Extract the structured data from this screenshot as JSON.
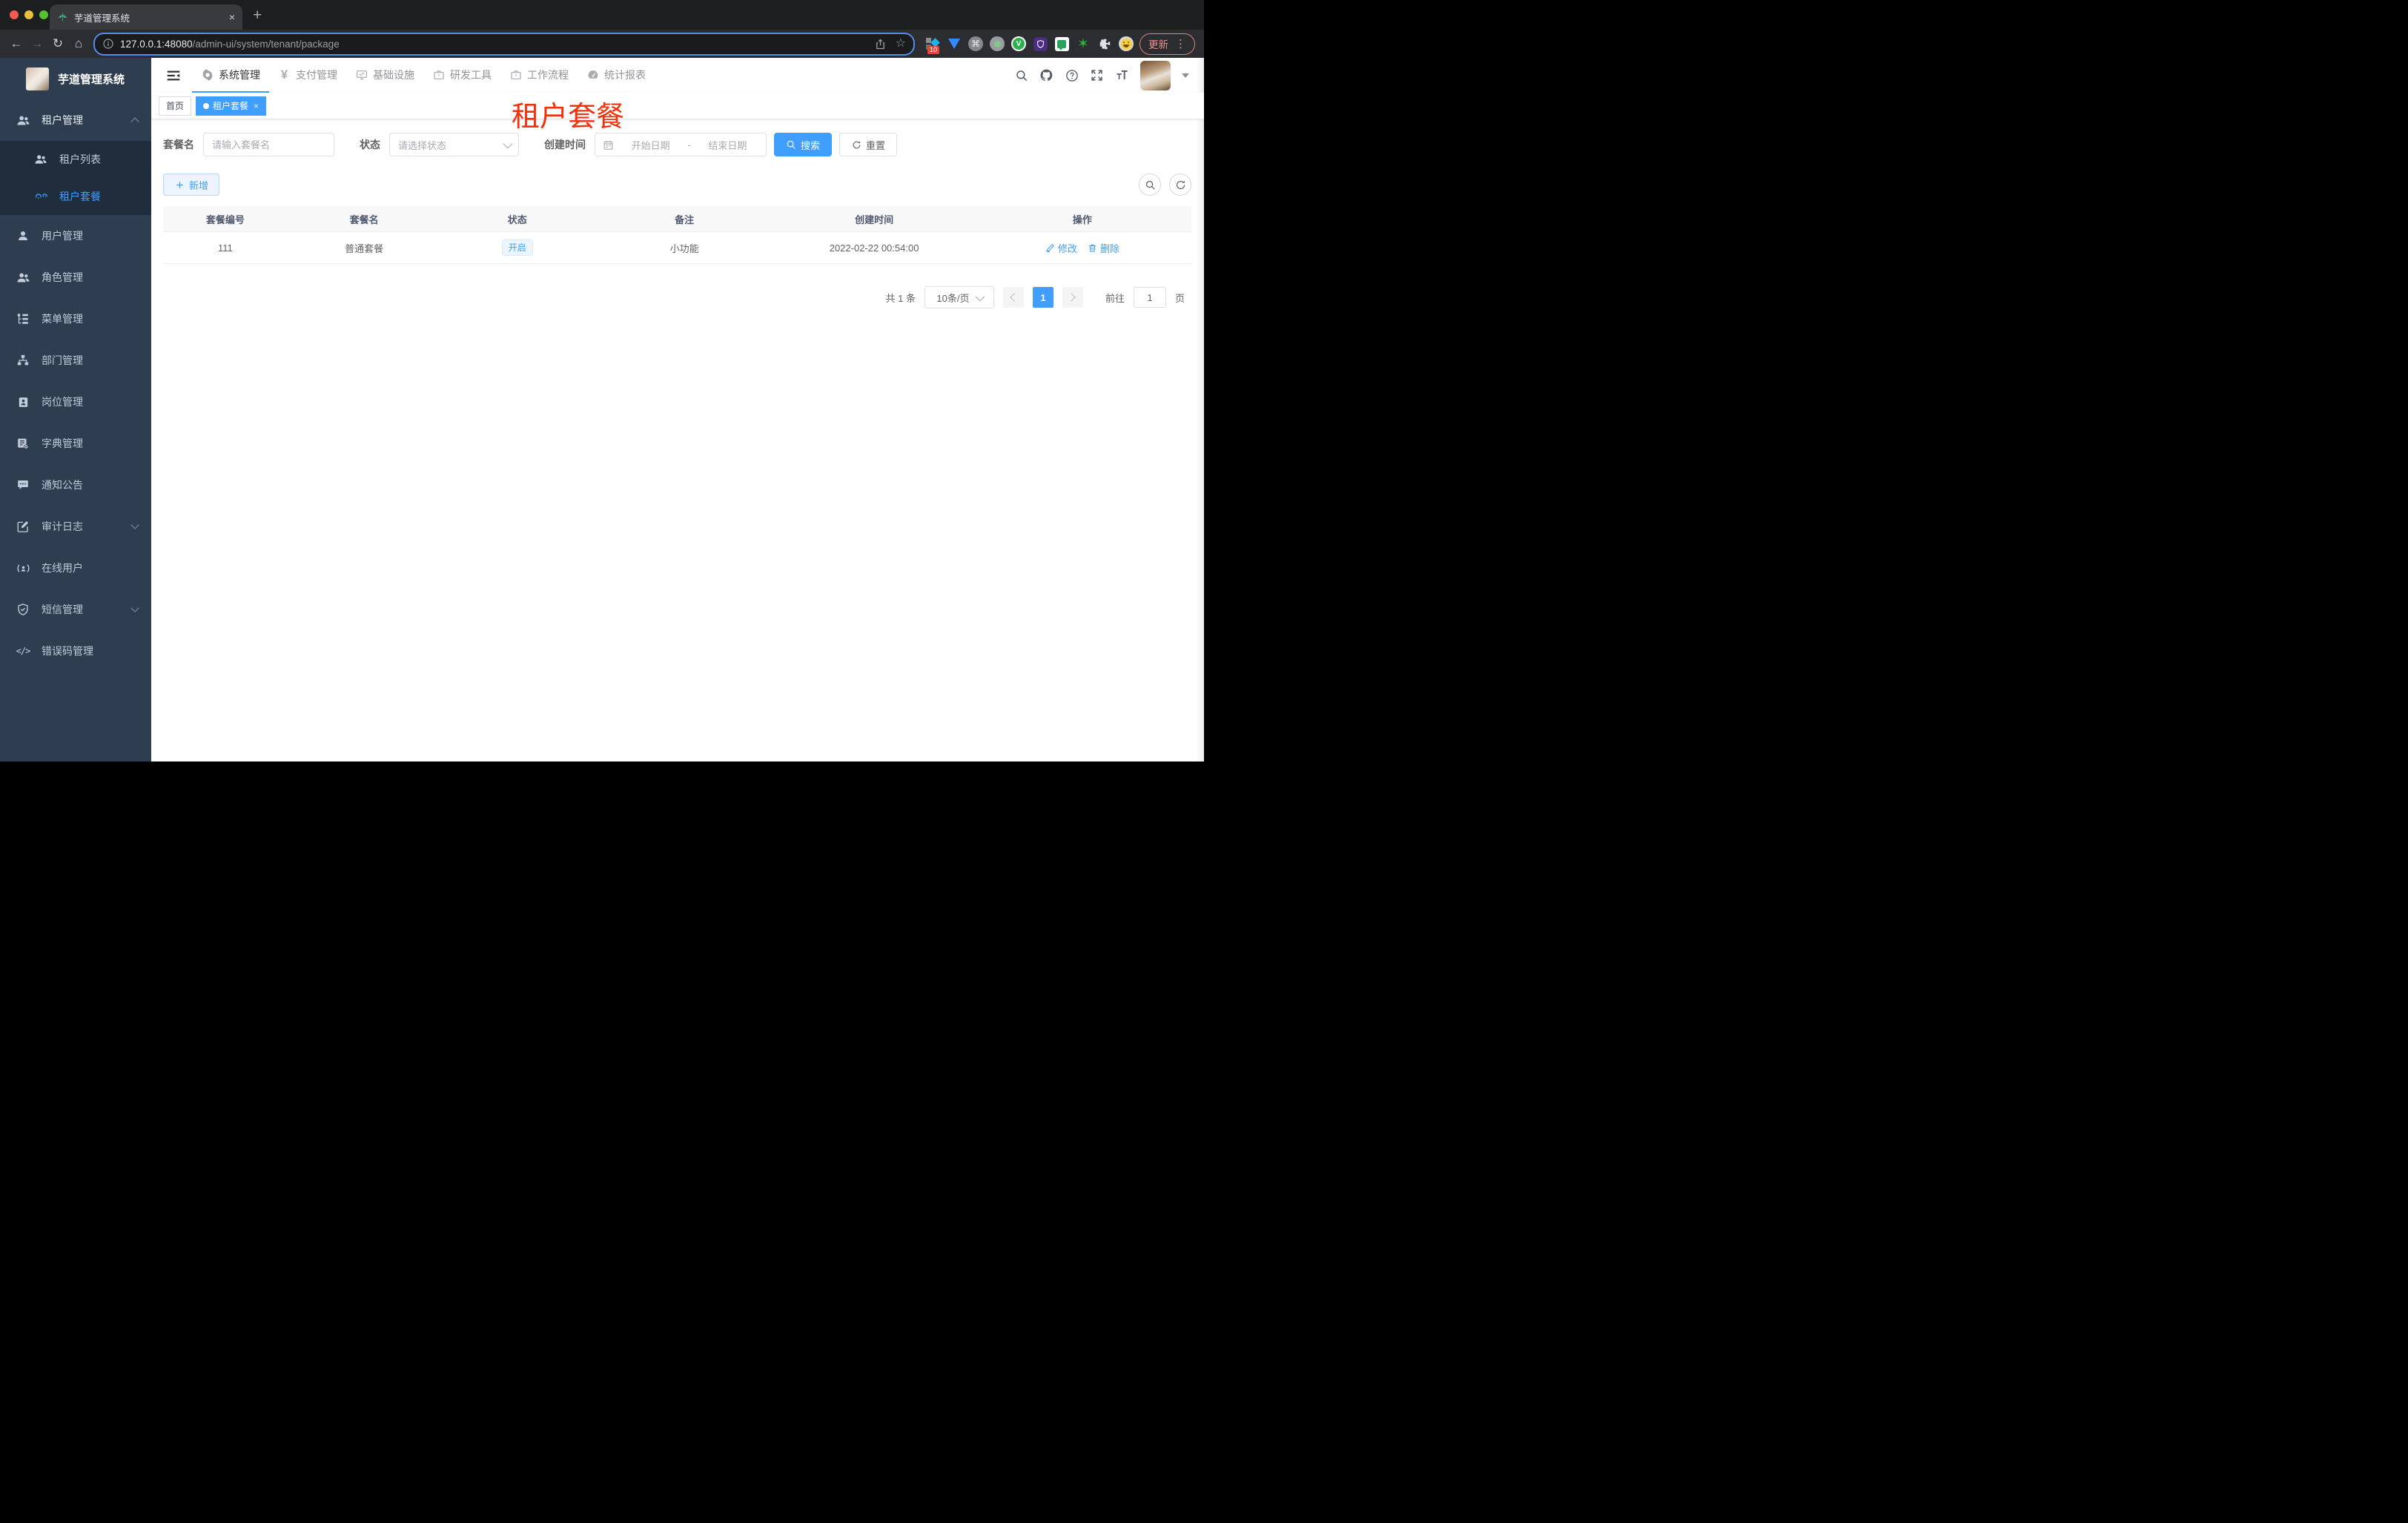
{
  "browser": {
    "tab_title": "芋道管理系统",
    "tab_close": "×",
    "new_tab": "+",
    "back": "←",
    "forward": "→",
    "reload": "↻",
    "home": "⌂",
    "url_host": "127.0.0.1:48080",
    "url_path": "/admin-ui/system/tenant/package",
    "star": "☆",
    "extension_badge": "10",
    "ext_command": "⌘",
    "ext_vue": "V",
    "ext_star": "✶",
    "update_label": "更新",
    "menu_dots": "⋮"
  },
  "sidebar": {
    "logo_title": "芋道管理系统",
    "tenant_group": {
      "label": "租户管理",
      "children": [
        {
          "label": "租户列表"
        },
        {
          "label": "租户套餐"
        }
      ]
    },
    "items": [
      {
        "label": "用户管理"
      },
      {
        "label": "角色管理"
      },
      {
        "label": "菜单管理"
      },
      {
        "label": "部门管理"
      },
      {
        "label": "岗位管理"
      },
      {
        "label": "字典管理"
      },
      {
        "label": "通知公告"
      },
      {
        "label": "审计日志"
      },
      {
        "label": "在线用户"
      },
      {
        "label": "短信管理"
      },
      {
        "label": "错误码管理"
      }
    ]
  },
  "topnav": {
    "yen": "¥",
    "items": [
      {
        "label": "系统管理"
      },
      {
        "label": "支付管理"
      },
      {
        "label": "基础设施"
      },
      {
        "label": "研发工具"
      },
      {
        "label": "工作流程"
      },
      {
        "label": "统计报表"
      }
    ]
  },
  "tags": {
    "home": "首页",
    "active": "租户套餐",
    "close": "×"
  },
  "overlay_title": "租户套餐",
  "filters": {
    "name_label": "套餐名",
    "name_placeholder": "请输入套餐名",
    "status_label": "状态",
    "status_placeholder": "请选择状态",
    "date_label": "创建时间",
    "date_start": "开始日期",
    "date_separator": "-",
    "date_end": "结束日期",
    "search_label": "搜索",
    "reset_label": "重置",
    "add_label": "新增"
  },
  "table": {
    "headers": [
      "套餐编号",
      "套餐名",
      "状态",
      "备注",
      "创建时间",
      "操作"
    ],
    "rows": [
      {
        "id": "111",
        "name": "普通套餐",
        "status": "开启",
        "remark": "小功能",
        "created": "2022-02-22 00:54:00",
        "edit": "修改",
        "delete": "删除"
      }
    ]
  },
  "pagination": {
    "total": "共 1 条",
    "page_size": "10条/页",
    "page": "1",
    "goto_label": "前往",
    "goto_value": "1",
    "unit": "页"
  },
  "colors": {
    "primary": "#409eff",
    "overlay_red": "#f2300c",
    "sidebar_bg": "#2f3d50",
    "submenu_bg": "#1f2d3d"
  }
}
